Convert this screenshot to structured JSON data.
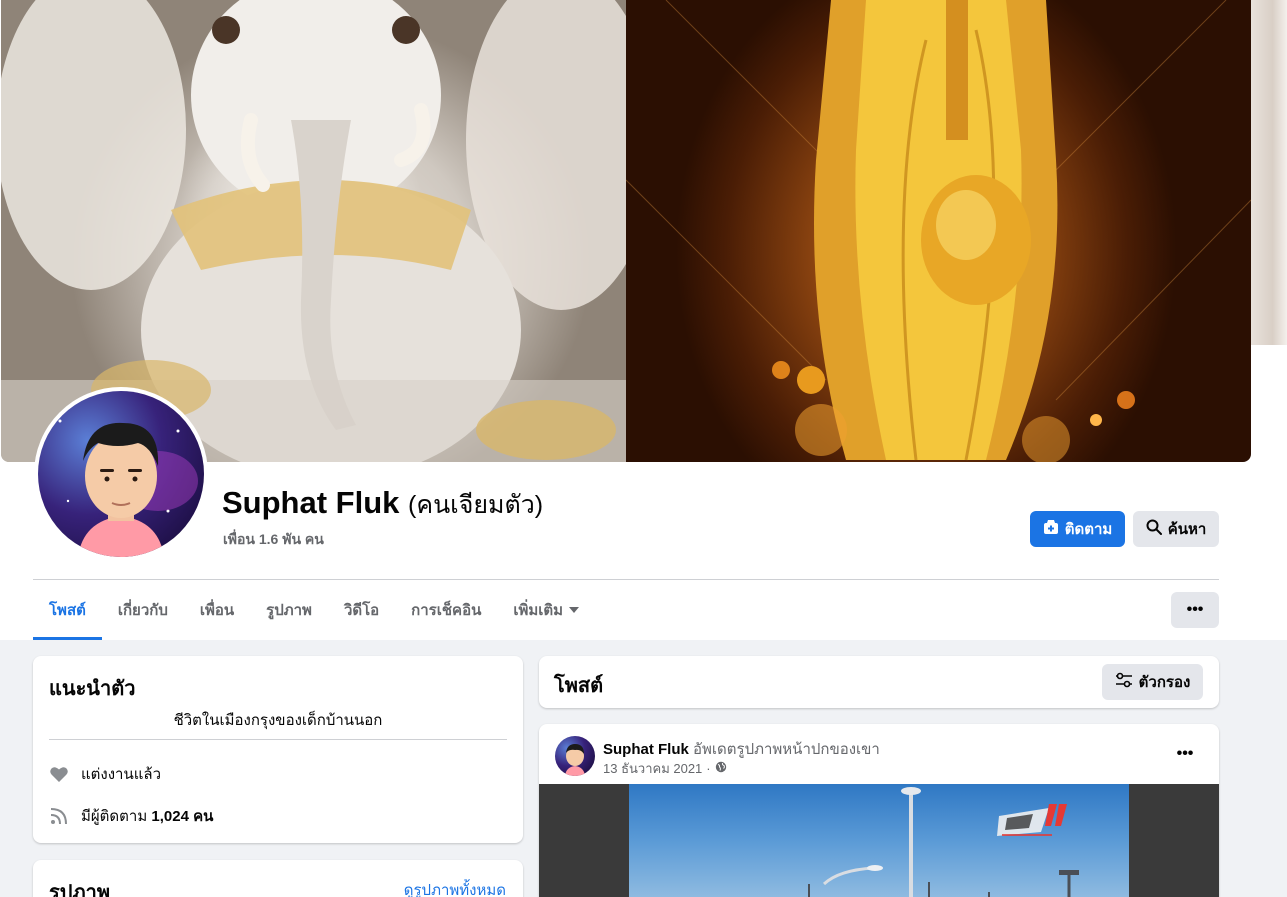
{
  "profile": {
    "name": "Suphat Fluk",
    "alternate_name": "(คนเจียมตัว)",
    "friends": "เพื่อน 1.6 พัน คน"
  },
  "actions": {
    "follow_label": "ติดตาม",
    "search_label": "ค้นหา",
    "more_label": "•••"
  },
  "tabs": [
    {
      "label": "โพสต์",
      "active": true
    },
    {
      "label": "เกี่ยวกับ"
    },
    {
      "label": "เพื่อน"
    },
    {
      "label": "รูปภาพ"
    },
    {
      "label": "วิดีโอ"
    },
    {
      "label": "การเช็คอิน"
    },
    {
      "label": "เพิ่มเติม"
    }
  ],
  "intro": {
    "title": "แนะนำตัว",
    "bio": "ชีวิตในเมืองกรุงของเด็กบ้านนอก",
    "relationship": "แต่งงานแล้ว",
    "followers_prefix": "มีผู้ติดตาม",
    "followers_count": "1,024 คน"
  },
  "photos": {
    "title": "รูปภาพ",
    "see_all": "ดูรูปภาพทั้งหมด"
  },
  "posts": {
    "title": "โพสต์",
    "filter_label": "ตัวกรอง"
  },
  "post": {
    "author": "Suphat Fluk",
    "action": "อัพเดตรูปภาพหน้าปกของเขา",
    "date": "13 ธันวาคม 2021",
    "separator": "·",
    "more_label": "•••"
  },
  "colors": {
    "accent": "#1b74e4",
    "background": "#f0f2f5",
    "secondary_text": "#65676b"
  }
}
